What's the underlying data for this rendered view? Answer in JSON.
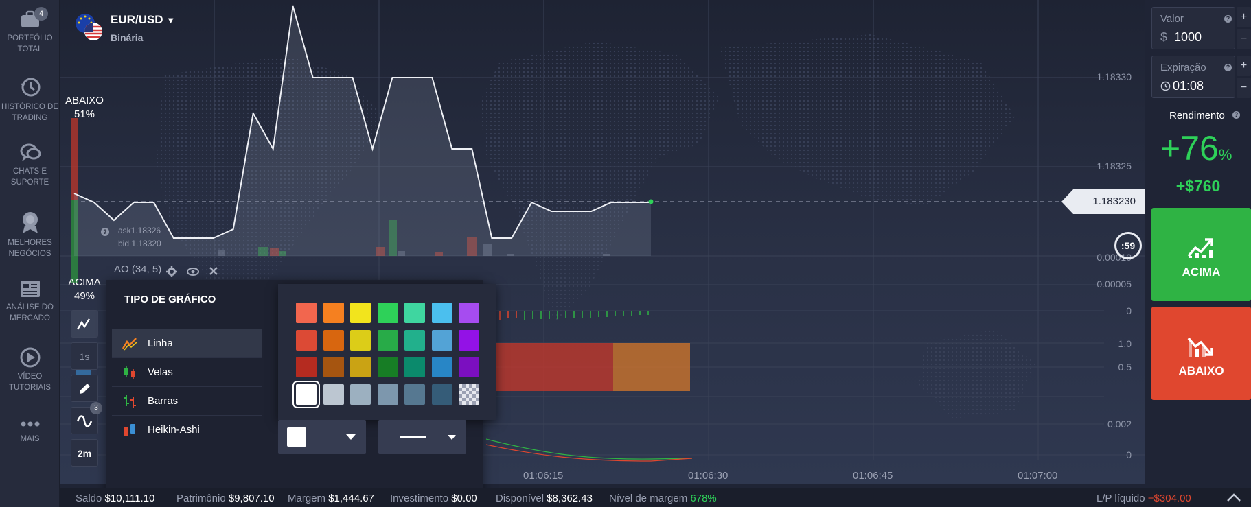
{
  "nav": {
    "items": [
      {
        "label": "PORTFÓLIO TOTAL",
        "icon": "briefcase-icon",
        "badge": "4"
      },
      {
        "label": "HISTÓRICO DE TRADING",
        "icon": "history-icon"
      },
      {
        "label": "CHATS E SUPORTE",
        "icon": "chat-icon"
      },
      {
        "label": "MELHORES NEGÓCIOS",
        "icon": "medal-icon"
      },
      {
        "label": "ANÁLISE DO MERCADO",
        "icon": "news-icon"
      },
      {
        "label": "VÍDEO TUTORIAIS",
        "icon": "play-icon"
      },
      {
        "label": "MAIS",
        "icon": "more-icon"
      }
    ]
  },
  "asset": {
    "name": "EUR/USD",
    "type": "Binária"
  },
  "sentiment": {
    "down_label": "ABAIXO",
    "down_pct": "51%",
    "up_label": "ACIMA",
    "up_pct": "49%"
  },
  "quote": {
    "ask": "ask1.18326",
    "bid": "bid 1.18320",
    "current": "1.183230",
    "timer": ":59"
  },
  "axis": {
    "prices": [
      "1.18330",
      "1.18325"
    ],
    "ao_ticks": [
      "0.00010",
      "0.00005",
      "0"
    ],
    "osc_ticks": [
      "1.0",
      "0.5"
    ],
    "lower_ticks": [
      "0.002",
      "0"
    ],
    "times": [
      "01:06:15",
      "01:06:30",
      "01:06:45",
      "01:07:00"
    ]
  },
  "chart_data": {
    "type": "line",
    "series": [
      {
        "values": [
          1.183235,
          1.18323,
          1.18322,
          1.18323,
          1.18323,
          1.18321,
          1.18321,
          1.18321,
          1.183215,
          1.18328,
          1.18326,
          1.18334,
          1.1833,
          1.1833,
          1.1833,
          1.18326,
          1.1833,
          1.1833,
          1.1833,
          1.18326,
          1.18326,
          1.18321,
          1.18321,
          1.18323,
          1.183225,
          1.183225,
          1.183225,
          1.18323,
          1.18323,
          1.18323
        ]
      }
    ],
    "xlabel": "",
    "ylabel": "",
    "ylim": [
      1.18314,
      1.18336
    ]
  },
  "indicator": {
    "label": "AO (34, 5)"
  },
  "tools": {
    "timeframe": "1s",
    "period": "2m",
    "indicator_badge": "3"
  },
  "chart_type_panel": {
    "title": "TIPO DE GRÁFICO",
    "items": [
      {
        "label": "Linha",
        "icon": "line-chart-icon",
        "active": true
      },
      {
        "label": "Velas",
        "icon": "candles-icon",
        "active": false
      },
      {
        "label": "Barras",
        "icon": "bars-icon",
        "active": false
      },
      {
        "label": "Heikin-Ashi",
        "icon": "heikin-ashi-icon",
        "active": false
      }
    ]
  },
  "color_picker": {
    "colors": [
      [
        "#f2664e",
        "#f58020",
        "#f2e41d",
        "#2ed159",
        "#3fd6a0",
        "#4bbfee",
        "#a64cf0"
      ],
      [
        "#dc4a35",
        "#d8660f",
        "#dccd18",
        "#28ab48",
        "#22b08c",
        "#53a3d6",
        "#9312e6"
      ],
      [
        "#b52b20",
        "#a65510",
        "#caa314",
        "#177d25",
        "#0b8a6c",
        "#2886c6",
        "#7b0fc0"
      ],
      [
        "#ffffff",
        "#bcc6d1",
        "#9cb0c0",
        "#7d97ad",
        "#567891",
        "#355c78",
        "checkered"
      ]
    ],
    "selected": "#ffffff"
  },
  "trade": {
    "value_label": "Valor",
    "currency": "$",
    "value": "1000",
    "expiry_label": "Expiração",
    "expiry": "01:08",
    "yield_label": "Rendimento",
    "yield_pct": "+76",
    "yield_pct_sign": "%",
    "profit": "+$760",
    "up_label": "ACIMA",
    "down_label": "ABAIXO"
  },
  "status": {
    "saldo_label": "Saldo",
    "saldo": "$10,111.10",
    "patrimonio_label": "Patrimônio",
    "patrimonio": "$9,807.10",
    "margem_label": "Margem",
    "margem": "$1,444.67",
    "investimento_label": "Investimento",
    "investimento": "$0.00",
    "disponivel_label": "Disponível",
    "disponivel": "$8,362.43",
    "nivel_label": "Nível de margem",
    "nivel": "678%",
    "lp_label": "L/P líquido",
    "lp": "−$304.00"
  },
  "colors": {
    "up": "#2fb344",
    "down": "#e0472f",
    "accent_green": "#2ed159"
  }
}
